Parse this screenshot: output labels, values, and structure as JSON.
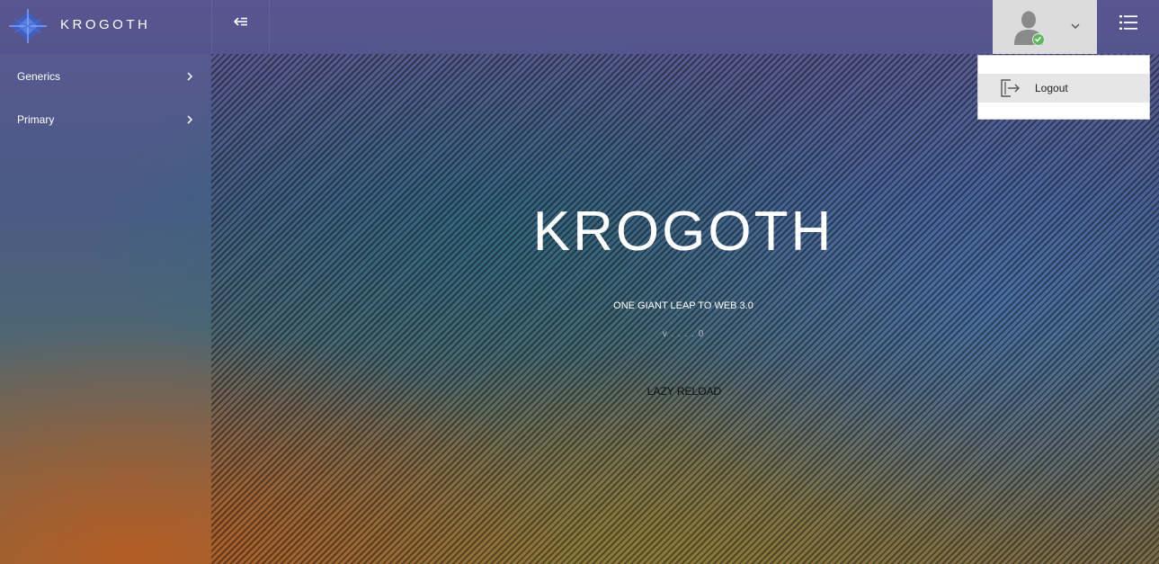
{
  "app": {
    "brand_name": "KROGOTH"
  },
  "header": {
    "toggle_icon": "collapse-arrow-icon",
    "user_status_color": "#5cb85c",
    "menu_icon": "list-icon"
  },
  "sidebar": {
    "items": [
      {
        "label": "Generics"
      },
      {
        "label": "Primary"
      }
    ]
  },
  "user_menu": {
    "items": [
      {
        "label": "Logout",
        "icon": "logout-icon"
      }
    ]
  },
  "hero": {
    "title": "KROGOTH",
    "subtitle": "ONE GIANT LEAP TO WEB 3.0",
    "version": "v . . . . 0",
    "reload_label": "LAZY RELOAD"
  }
}
